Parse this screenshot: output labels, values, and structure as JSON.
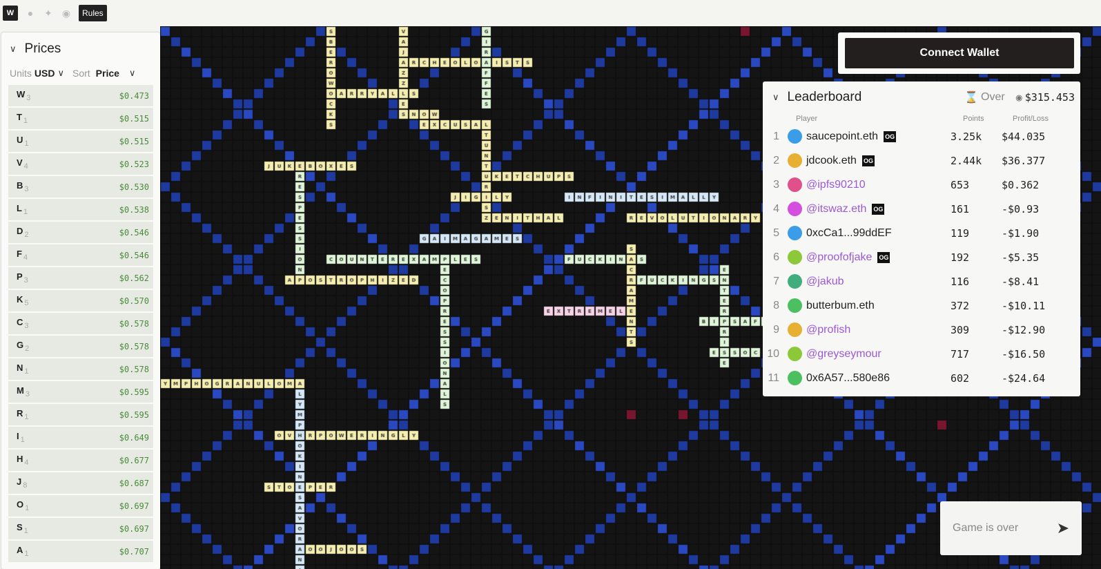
{
  "topbar": {
    "logo": "W",
    "icons": [
      "github-icon",
      "twitter-icon",
      "discord-icon"
    ],
    "rules_label": "Rules"
  },
  "prices": {
    "title": "Prices",
    "units_label": "Units",
    "units_value": "USD",
    "sort_label": "Sort",
    "sort_value": "Price",
    "items": [
      {
        "letter": "W",
        "points": "3",
        "price": "$0.473"
      },
      {
        "letter": "T",
        "points": "1",
        "price": "$0.515"
      },
      {
        "letter": "U",
        "points": "1",
        "price": "$0.515"
      },
      {
        "letter": "V",
        "points": "4",
        "price": "$0.523"
      },
      {
        "letter": "B",
        "points": "3",
        "price": "$0.530"
      },
      {
        "letter": "L",
        "points": "1",
        "price": "$0.538"
      },
      {
        "letter": "D",
        "points": "2",
        "price": "$0.546"
      },
      {
        "letter": "F",
        "points": "4",
        "price": "$0.546"
      },
      {
        "letter": "P",
        "points": "3",
        "price": "$0.562"
      },
      {
        "letter": "K",
        "points": "5",
        "price": "$0.570"
      },
      {
        "letter": "C",
        "points": "3",
        "price": "$0.578"
      },
      {
        "letter": "G",
        "points": "2",
        "price": "$0.578"
      },
      {
        "letter": "N",
        "points": "1",
        "price": "$0.578"
      },
      {
        "letter": "M",
        "points": "3",
        "price": "$0.595"
      },
      {
        "letter": "R",
        "points": "1",
        "price": "$0.595"
      },
      {
        "letter": "I",
        "points": "1",
        "price": "$0.649"
      },
      {
        "letter": "H",
        "points": "4",
        "price": "$0.677"
      },
      {
        "letter": "J",
        "points": "8",
        "price": "$0.687"
      },
      {
        "letter": "O",
        "points": "1",
        "price": "$0.697"
      },
      {
        "letter": "S",
        "points": "1",
        "price": "$0.697"
      },
      {
        "letter": "A",
        "points": "1",
        "price": "$0.707"
      }
    ]
  },
  "wallet": {
    "label": "Connect Wallet"
  },
  "leaderboard": {
    "title": "Leaderboard",
    "status": "Over",
    "pot": "$315.453",
    "columns": {
      "player": "Player",
      "points": "Points",
      "pl": "Profit/Loss"
    },
    "og_label": "OG",
    "rows": [
      {
        "rank": "1",
        "name": "saucepoint.eth",
        "social": false,
        "og": true,
        "color": "#3b9de8",
        "points": "3.25k",
        "pl": "$44.035"
      },
      {
        "rank": "2",
        "name": "jdcook.eth",
        "social": false,
        "og": true,
        "color": "#e8b032",
        "points": "2.44k",
        "pl": "$36.377"
      },
      {
        "rank": "3",
        "name": "@ipfs90210",
        "social": true,
        "og": false,
        "color": "#e0508a",
        "points": "653",
        "pl": "$0.362"
      },
      {
        "rank": "4",
        "name": "@itswaz.eth",
        "social": true,
        "og": true,
        "color": "#d44fe0",
        "points": "161",
        "pl": "-$0.93"
      },
      {
        "rank": "5",
        "name": "0xcCa1...99ddEF",
        "social": false,
        "og": false,
        "color": "#3b9de8",
        "points": "119",
        "pl": "-$1.90"
      },
      {
        "rank": "6",
        "name": "@proofofjake",
        "social": true,
        "og": true,
        "color": "#8cc83a",
        "points": "192",
        "pl": "-$5.35"
      },
      {
        "rank": "7",
        "name": "@jakub",
        "social": true,
        "og": false,
        "color": "#3fae7c",
        "points": "116",
        "pl": "-$8.41"
      },
      {
        "rank": "8",
        "name": "butterbum.eth",
        "social": false,
        "og": false,
        "color": "#4cc060",
        "points": "372",
        "pl": "-$10.11"
      },
      {
        "rank": "9",
        "name": "@profish",
        "social": true,
        "og": false,
        "color": "#e8b032",
        "points": "309",
        "pl": "-$12.90"
      },
      {
        "rank": "10",
        "name": "@greyseymour",
        "social": true,
        "og": false,
        "color": "#8cc83a",
        "points": "717",
        "pl": "-$16.50"
      },
      {
        "rank": "11",
        "name": "0x6A57...580e86",
        "social": false,
        "og": false,
        "color": "#4cc060",
        "points": "602",
        "pl": "-$24.64"
      }
    ]
  },
  "chat": {
    "placeholder": "Game is over"
  },
  "board": {
    "colors": {
      "yellow": "#f5eeb0",
      "green": "#dff5d8",
      "blue": "#d6e8f7",
      "pink": "#f6d3e6",
      "empty": "#141414",
      "diag": "#1f3a9e",
      "red": "#7a1530"
    },
    "words": [
      {
        "text": "ARCHEOLOGISTS",
        "dir": "h",
        "col": 23,
        "row": 3,
        "color": "yellow"
      },
      {
        "text": "CARRYALLS",
        "dir": "h",
        "col": 16,
        "row": 6,
        "color": "yellow"
      },
      {
        "text": "SNOW",
        "dir": "h",
        "col": 23,
        "row": 8,
        "color": "yellow"
      },
      {
        "text": "EXCUSAL",
        "dir": "h",
        "col": 25,
        "row": 9,
        "color": "yellow"
      },
      {
        "text": "JUKEBOXES",
        "dir": "h",
        "col": 10,
        "row": 13,
        "color": "yellow"
      },
      {
        "text": "KETCHUPS",
        "dir": "h",
        "col": 32,
        "row": 14,
        "color": "yellow"
      },
      {
        "text": "JIGGLY",
        "dir": "h",
        "col": 28,
        "row": 16,
        "color": "yellow"
      },
      {
        "text": "INFINITESIMALLY",
        "dir": "h",
        "col": 39,
        "row": 16,
        "color": "blue"
      },
      {
        "text": "ZENITHAL",
        "dir": "h",
        "col": 31,
        "row": 18,
        "color": "yellow"
      },
      {
        "text": "REVOLUTIONARY",
        "dir": "h",
        "col": 45,
        "row": 18,
        "color": "yellow"
      },
      {
        "text": "GAIMAGAMES",
        "dir": "h",
        "col": 25,
        "row": 20,
        "color": "blue"
      },
      {
        "text": "COUNTEREXAMPLES",
        "dir": "h",
        "col": 16,
        "row": 22,
        "color": "green"
      },
      {
        "text": "FUCKINGS",
        "dir": "h",
        "col": 39,
        "row": 22,
        "color": "green"
      },
      {
        "text": "APOSTROPHIZED",
        "dir": "h",
        "col": 12,
        "row": 24,
        "color": "yellow"
      },
      {
        "text": "FUCKINGS",
        "dir": "h",
        "col": 46,
        "row": 24,
        "color": "green"
      },
      {
        "text": "EXTREMELY",
        "dir": "h",
        "col": 37,
        "row": 27,
        "color": "pink"
      },
      {
        "text": "BIOSAFE",
        "dir": "h",
        "col": 52,
        "row": 28,
        "color": "green"
      },
      {
        "text": "ESSOC",
        "dir": "h",
        "col": 53,
        "row": 31,
        "color": "green"
      },
      {
        "text": "YMPHOGRANULOMA",
        "dir": "h",
        "col": 0,
        "row": 34,
        "color": "yellow"
      },
      {
        "text": "OVERPOWERINGLY",
        "dir": "h",
        "col": 11,
        "row": 39,
        "color": "yellow"
      },
      {
        "text": "STOPPER",
        "dir": "h",
        "col": 10,
        "row": 44,
        "color": "yellow"
      },
      {
        "text": "JOOJOOS",
        "dir": "h",
        "col": 13,
        "row": 50,
        "color": "yellow"
      },
      {
        "text": "SBEROWOCKS",
        "dir": "v",
        "col": 16,
        "row": 0,
        "color": "yellow"
      },
      {
        "text": "VAJAZZLE",
        "dir": "v",
        "col": 23,
        "row": 0,
        "color": "yellow"
      },
      {
        "text": "GIRAFFES",
        "dir": "v",
        "col": 31,
        "row": 0,
        "color": "green"
      },
      {
        "text": "RESPESSION",
        "dir": "v",
        "col": 13,
        "row": 14,
        "color": "green"
      },
      {
        "text": "TUNTURIS",
        "dir": "v",
        "col": 31,
        "row": 10,
        "color": "yellow"
      },
      {
        "text": "LYMPHOKINES",
        "dir": "v",
        "col": 13,
        "row": 35,
        "color": "blue"
      },
      {
        "text": "SAVORANJ",
        "dir": "v",
        "col": 13,
        "row": 45,
        "color": "blue"
      },
      {
        "text": "ECOPRESSIONALS",
        "dir": "v",
        "col": 27,
        "row": 23,
        "color": "green"
      },
      {
        "text": "SACRAMENTS",
        "dir": "v",
        "col": 45,
        "row": 21,
        "color": "yellow"
      },
      {
        "text": "ENTERPRISE",
        "dir": "v",
        "col": 54,
        "row": 23,
        "color": "green"
      }
    ]
  }
}
